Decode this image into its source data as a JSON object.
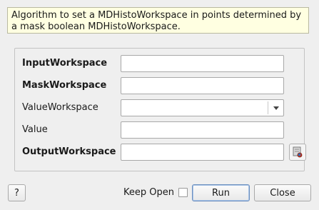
{
  "description": "Algorithm to set a MDHistoWorkspace in points determined by a mask boolean MDHistoWorkspace.",
  "properties": [
    {
      "label": "InputWorkspace",
      "bold": true,
      "value": ""
    },
    {
      "label": "MaskWorkspace",
      "bold": true,
      "value": ""
    },
    {
      "label": "ValueWorkspace",
      "bold": false,
      "value": ""
    },
    {
      "label": "Value",
      "bold": false,
      "value": ""
    },
    {
      "label": "OutputWorkspace",
      "bold": true,
      "value": ""
    }
  ],
  "icons": {
    "browse": "workspace-browse-icon",
    "dropdown": "chevron-down-icon"
  },
  "footer": {
    "help_label": "?",
    "keep_open_label": "Keep Open",
    "keep_open_checked": false,
    "run_label": "Run",
    "close_label": "Close"
  },
  "colors": {
    "description_bg": "#ffffe1",
    "window_bg": "#efefef",
    "default_button_border": "#6b8fbf"
  }
}
